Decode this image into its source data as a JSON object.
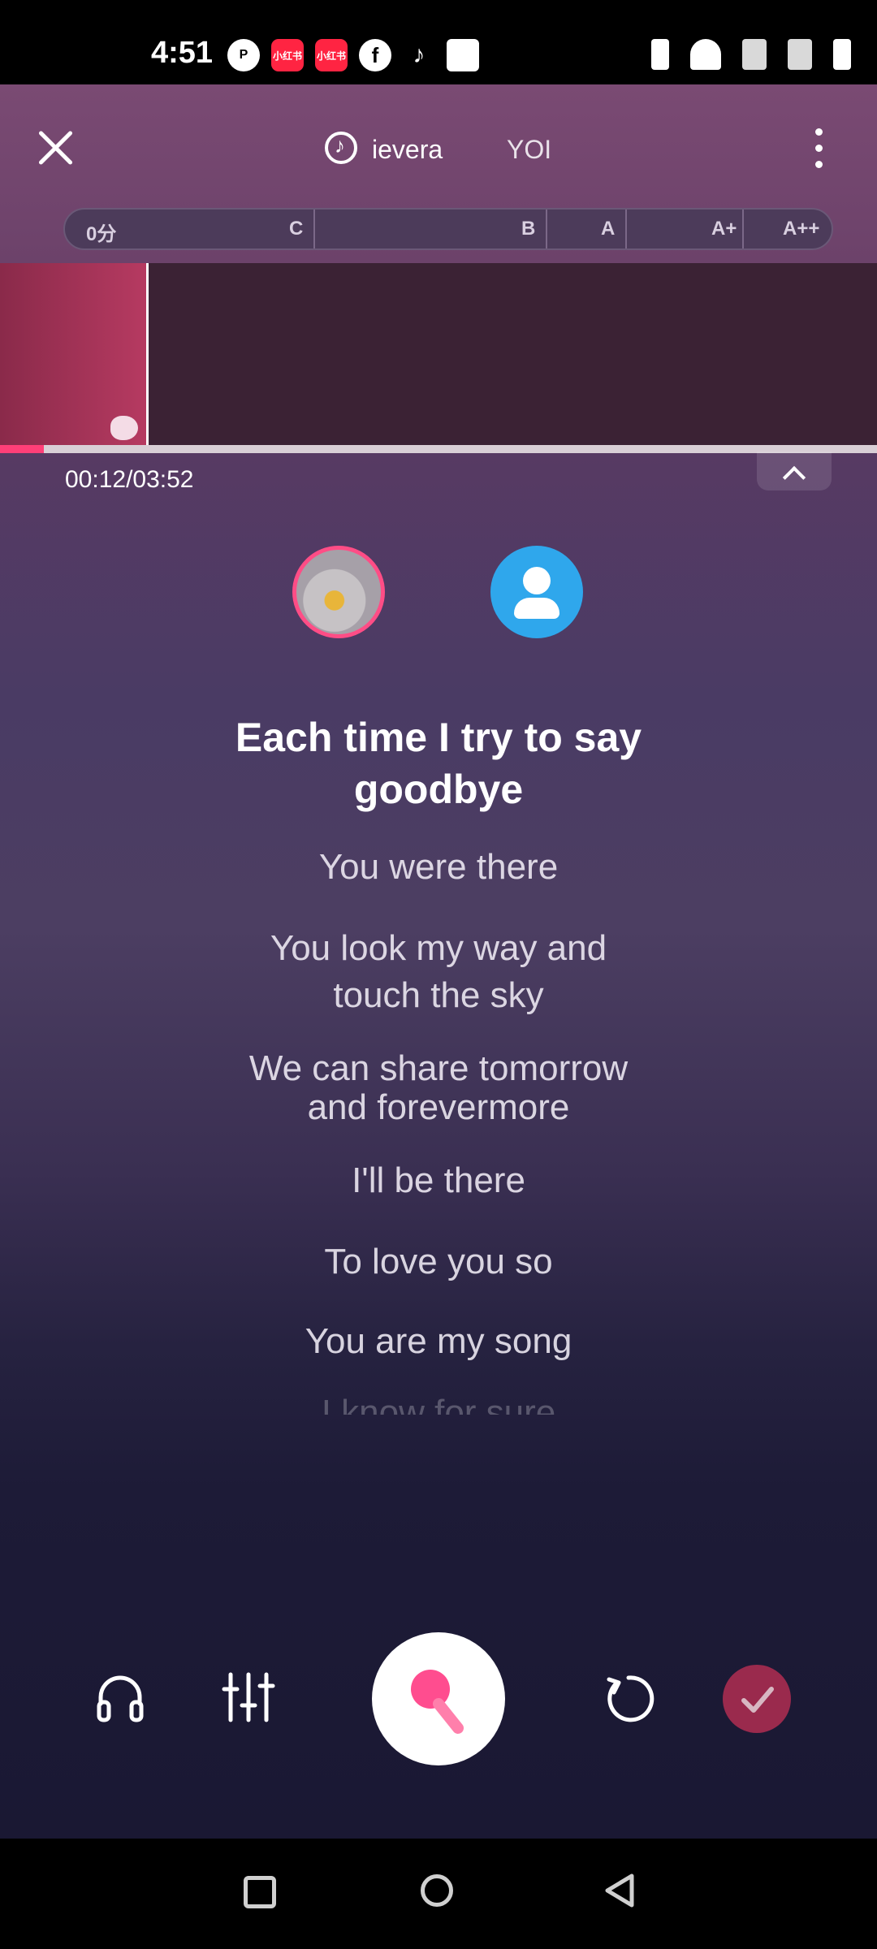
{
  "status_bar": {
    "time": "4:51",
    "app_icons": [
      "p-icon",
      "xiaohongshu-icon",
      "xiaohongshu-icon",
      "facebook-icon",
      "tiktok-icon",
      "message-icon"
    ],
    "xhs_label": "小红书"
  },
  "header": {
    "song_title": "ievera",
    "song_title_2": "YOI"
  },
  "score_bar": {
    "score": "0分",
    "grades": [
      "C",
      "B",
      "A",
      "A+",
      "A++"
    ]
  },
  "playback": {
    "time": "00:12/03:52",
    "progress": 0.05
  },
  "lyrics": {
    "current": [
      "Each time I try to say",
      "goodbye"
    ],
    "upcoming": [
      [
        "You were there"
      ],
      [
        "You look my way and",
        "touch the sky"
      ],
      [
        "We can share tomorrow",
        "and forevermore"
      ],
      [
        "I'll be there"
      ],
      [
        "To love you so"
      ],
      [
        "You are my song"
      ]
    ],
    "partial": "I know for sure"
  },
  "controls": {
    "headphone": "headphone-icon",
    "mixer": "mixer-icon",
    "record": "microphone-icon",
    "retry": "retry-icon",
    "done": "check-icon"
  },
  "colors": {
    "accent": "#ff4d86",
    "done_button": "#9a2a4d",
    "avatar_blue": "#2fa7ec"
  }
}
